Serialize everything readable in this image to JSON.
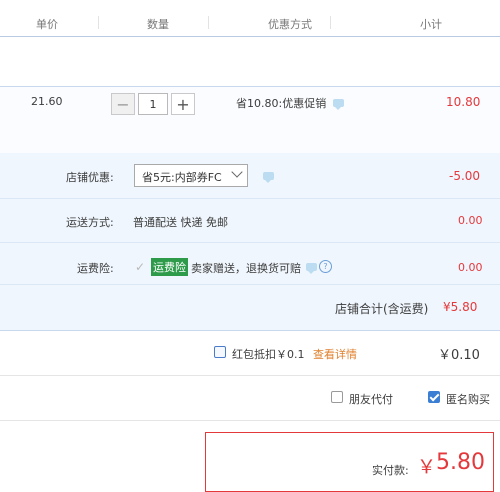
{
  "header": {
    "price_label": "单价",
    "qty_label": "数量",
    "promo_label": "优惠方式",
    "subtotal_label": "小计"
  },
  "item": {
    "unit_price": "21.60",
    "quantity": "1",
    "promo_text": "省10.80:优惠促销",
    "subtotal": "10.80"
  },
  "shop": {
    "discount_label": "店铺优惠:",
    "discount_selected": "省5元:内部券FC",
    "discount_amount": "-5.00",
    "shipping_label": "运送方式:",
    "shipping_value": "普通配送 快递 免邮",
    "shipping_amount": "0.00",
    "insurance_label": "运费险:",
    "insurance_badge": "运费险",
    "insurance_text": "卖家赠送，退换货可赔",
    "insurance_amount": "0.00",
    "total_label": "店铺合计(含运费)",
    "total_value": "¥5.80"
  },
  "redpacket": {
    "label": "红包抵扣￥0.1",
    "details_link": "查看详情",
    "amount": "￥0.10"
  },
  "options": {
    "friend_pay": "朋友代付",
    "anonymous": "匿名购买"
  },
  "payment": {
    "label": "实付款:",
    "currency": "￥",
    "amount": "5.80"
  },
  "colors": {
    "accent_red": "#e4393c",
    "badge_green": "#2e9b4b",
    "link_orange": "#e0802e",
    "checkbox_blue": "#3b7fd4"
  }
}
